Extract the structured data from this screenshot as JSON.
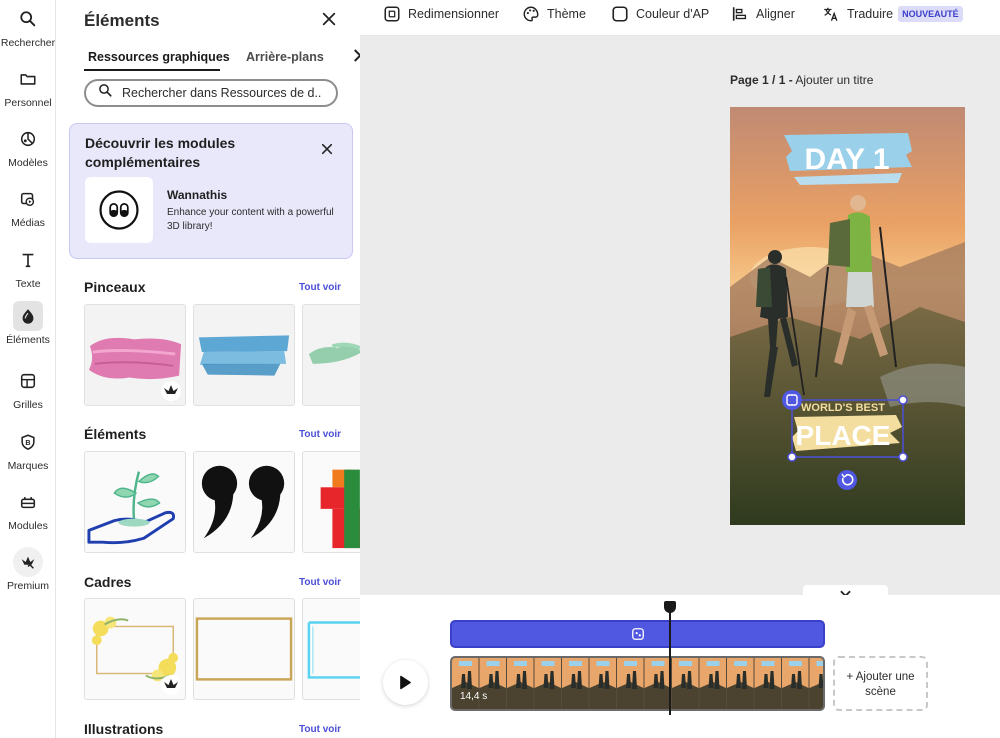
{
  "rail": {
    "items": [
      {
        "label": "Rechercher",
        "icon": "search-icon"
      },
      {
        "label": "Personnel",
        "icon": "folder-icon"
      },
      {
        "label": "Modèles",
        "icon": "templates-icon"
      },
      {
        "label": "Médias",
        "icon": "media-icon"
      },
      {
        "label": "Texte",
        "icon": "text-icon"
      },
      {
        "label": "Éléments",
        "icon": "elements-icon",
        "active": true
      },
      {
        "label": "Grilles",
        "icon": "grid-icon"
      },
      {
        "label": "Marques",
        "icon": "brand-icon"
      },
      {
        "label": "Modules",
        "icon": "addons-icon"
      },
      {
        "label": "Premium",
        "icon": "premium-crown-icon"
      }
    ]
  },
  "panel": {
    "title": "Éléments",
    "tabs": [
      "Ressources graphiques",
      "Arrière-plans"
    ],
    "search_placeholder": "Rechercher dans Ressources de d...",
    "discover": {
      "title": "Découvrir les modules complémentaires",
      "addon_name": "Wannathis",
      "addon_desc": "Enhance your content with a powerful 3D library!"
    },
    "sections": [
      {
        "title": "Pinceaux",
        "see_all": "Tout voir"
      },
      {
        "title": "Éléments",
        "see_all": "Tout voir"
      },
      {
        "title": "Cadres",
        "see_all": "Tout voir"
      },
      {
        "title": "Illustrations",
        "see_all": "Tout voir"
      }
    ]
  },
  "toolbar": {
    "resize": "Redimensionner",
    "theme": "Thème",
    "bg_color": "Couleur d'AP",
    "align": "Aligner",
    "translate": "Traduire",
    "new_badge": "NOUVEAUTÉ"
  },
  "canvas": {
    "page_label": "Page 1 / 1 -",
    "add_title": "Ajouter un titre",
    "headline": "DAY 1",
    "sticker_small": "WORLD'S BEST",
    "sticker_big": "PLACE"
  },
  "timeline": {
    "duration": "14,4 s",
    "add_scene": "+ Ajouter une scène"
  },
  "colors": {
    "accent": "#5057e0",
    "link": "#4b4fd6",
    "discover_bg": "#e9e8fb",
    "new_badge_bg": "#dcdcf8"
  }
}
